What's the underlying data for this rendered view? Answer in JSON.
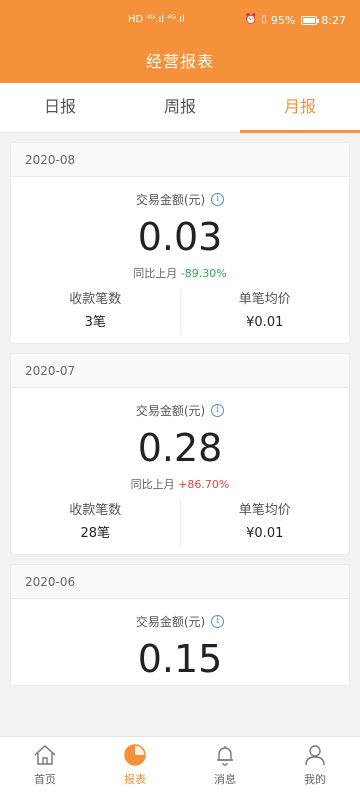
{
  "status_bar": {
    "left_icons": "HD ⁴ᴳ.ıl ⁴ᴳ.ıl",
    "battery": "95%",
    "time": "8:27"
  },
  "header": {
    "title": "经营报表"
  },
  "tabs": [
    {
      "label": "日报",
      "active": false
    },
    {
      "label": "周报",
      "active": false
    },
    {
      "label": "月报",
      "active": true
    }
  ],
  "cards": [
    {
      "period": "2020-08",
      "amount_label": "交易金额(元)",
      "amount": "0.03",
      "compare_label": "同比上月",
      "compare_value": "-89.30%",
      "count_label": "收款笔数",
      "count_value": "3笔",
      "avg_label": "单笔均价",
      "avg_value": "¥0.01"
    },
    {
      "period": "2020-07",
      "amount_label": "交易金额(元)",
      "amount": "0.28",
      "compare_label": "同比上月",
      "compare_value": "+86.70%",
      "count_label": "收款笔数",
      "count_value": "28笔",
      "avg_label": "单笔均价",
      "avg_value": "¥0.01"
    },
    {
      "period": "2020-06",
      "amount_label": "交易金额(元)",
      "amount": "0.15"
    }
  ],
  "tabbar": [
    {
      "label": "首页",
      "icon": "home-icon",
      "active": false
    },
    {
      "label": "报表",
      "icon": "pie-chart-icon",
      "active": true
    },
    {
      "label": "消息",
      "icon": "bell-icon",
      "active": false
    },
    {
      "label": "我的",
      "icon": "user-icon",
      "active": false
    }
  ],
  "colors": {
    "brand": "#f5913a",
    "down": "#2fa84f",
    "up": "#e0443b",
    "info": "#4a90e2"
  }
}
